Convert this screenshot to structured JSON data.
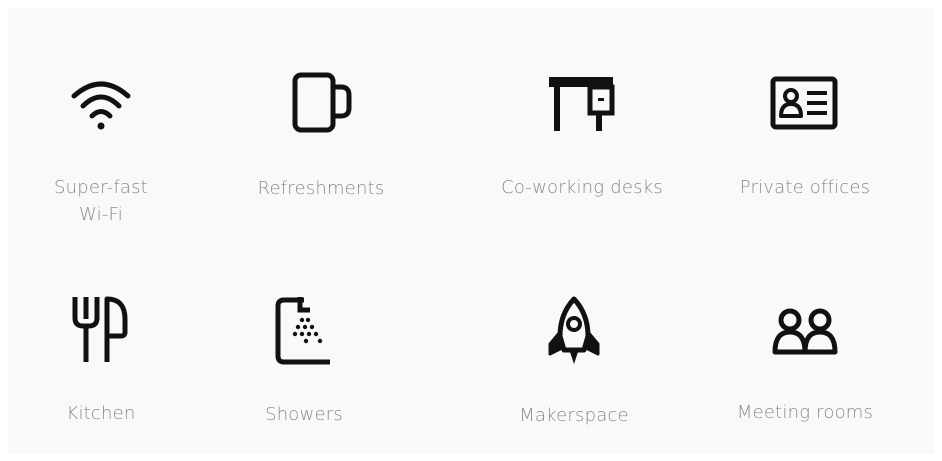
{
  "amenities": [
    {
      "label": "Super-fast\nWi-Fi",
      "icon": "wifi-icon"
    },
    {
      "label": "Refreshments",
      "icon": "mug-icon"
    },
    {
      "label": "Co-working desks",
      "icon": "desk-icon"
    },
    {
      "label": "Private offices",
      "icon": "id-card-icon"
    },
    {
      "label": "Kitchen",
      "icon": "fork-knife-icon"
    },
    {
      "label": "Showers",
      "icon": "shower-icon"
    },
    {
      "label": "Makerspace",
      "icon": "rocket-icon"
    },
    {
      "label": "Meeting rooms",
      "icon": "people-icon"
    }
  ],
  "colors": {
    "icon": "#111111",
    "label": "#8a8a8a",
    "background": "#f8f9fb"
  }
}
